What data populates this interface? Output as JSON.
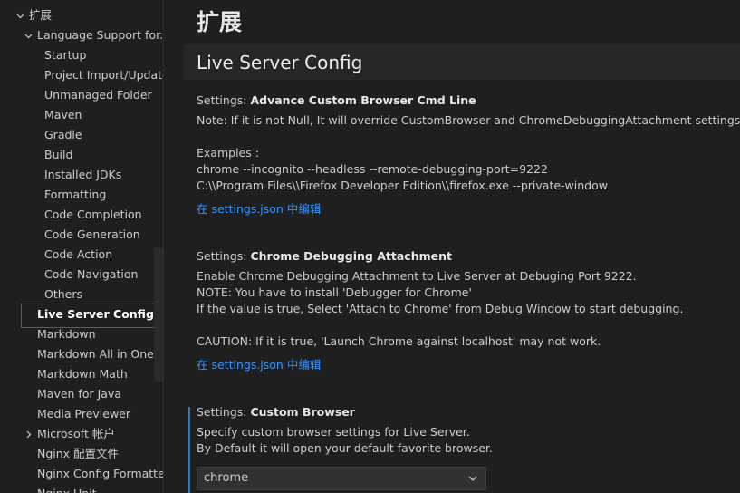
{
  "sidebar": {
    "items": [
      {
        "label": "扩展",
        "level": 0,
        "chevron": "down"
      },
      {
        "label": "Language Support for...",
        "level": 1,
        "chevron": "down"
      },
      {
        "label": "Startup",
        "level": 2
      },
      {
        "label": "Project Import/Update",
        "level": 2
      },
      {
        "label": "Unmanaged Folder",
        "level": 2
      },
      {
        "label": "Maven",
        "level": 2
      },
      {
        "label": "Gradle",
        "level": 2
      },
      {
        "label": "Build",
        "level": 2
      },
      {
        "label": "Installed JDKs",
        "level": 2
      },
      {
        "label": "Formatting",
        "level": 2
      },
      {
        "label": "Code Completion",
        "level": 2
      },
      {
        "label": "Code Generation",
        "level": 2
      },
      {
        "label": "Code Action",
        "level": 2
      },
      {
        "label": "Code Navigation",
        "level": 2
      },
      {
        "label": "Others",
        "level": 2
      },
      {
        "label": "Live Server Config",
        "level": 1,
        "active": true
      },
      {
        "label": "Markdown",
        "level": 1
      },
      {
        "label": "Markdown All in One",
        "level": 1
      },
      {
        "label": "Markdown Math",
        "level": 1
      },
      {
        "label": "Maven for Java",
        "level": 1
      },
      {
        "label": "Media Previewer",
        "level": 1
      },
      {
        "label": "Microsoft 帐户",
        "level": 1,
        "chevron": "right"
      },
      {
        "label": "Nginx 配置文件",
        "level": 1
      },
      {
        "label": "Nginx Config Formatter",
        "level": 1
      },
      {
        "label": "Nginx Unit",
        "level": 1
      }
    ]
  },
  "main": {
    "page_title": "扩展",
    "section_title": "Live Server Config",
    "settings": [
      {
        "category": "Settings: ",
        "name": "Advance Custom Browser Cmd Line",
        "lines": [
          "Note: If it is not Null, It will override CustomBrowser and ChromeDebuggingAttachment settings.",
          "",
          "Examples :",
          "chrome --incognito --headless --remote-debugging-port=9222",
          "C:\\\\Program Files\\\\Firefox Developer Edition\\\\firefox.exe --private-window"
        ],
        "link": "在 settings.json 中编辑"
      },
      {
        "category": "Settings: ",
        "name": "Chrome Debugging Attachment",
        "lines": [
          "Enable Chrome Debugging Attachment to Live Server at Debuging Port 9222.",
          "NOTE: You have to install 'Debugger for Chrome'",
          "If the value is true, Select 'Attach to Chrome' from Debug Window to start debugging.",
          "",
          "CAUTION: If it is true, 'Launch Chrome against localhost' may not work."
        ],
        "link": "在 settings.json 中编辑"
      },
      {
        "category": "Settings: ",
        "name": "Custom Browser",
        "lines": [
          "Specify custom browser settings for Live Server.",
          "By Default it will open your default favorite browser."
        ],
        "select_value": "chrome"
      }
    ]
  },
  "colors": {
    "background": "#1f1f1f",
    "link": "#3794ff",
    "highlight_border": "#e0232e",
    "focus_bar": "#2b7fc0"
  },
  "icons": {
    "expanded": "chevron-down-icon",
    "collapsed": "chevron-right-icon",
    "dropdown": "chevron-down-icon"
  }
}
